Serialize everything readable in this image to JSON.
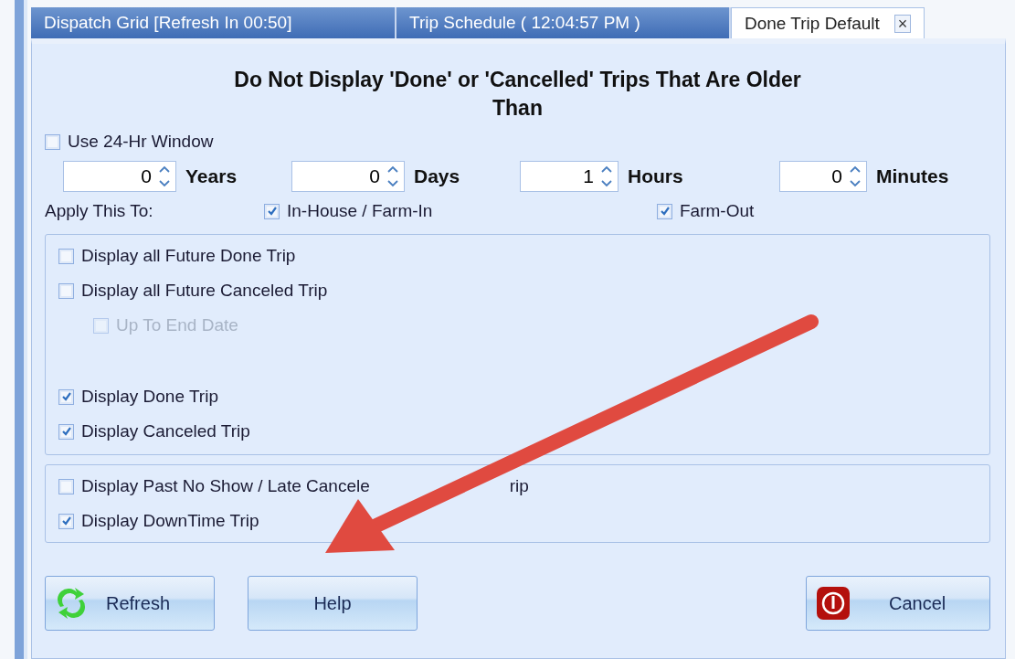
{
  "tabs": [
    {
      "label": "Dispatch Grid [Refresh In 00:50]",
      "selected": false,
      "closable": false
    },
    {
      "label": "Trip Schedule  ( 12:04:57 PM )",
      "selected": false,
      "closable": false
    },
    {
      "label": "Done Trip Default",
      "selected": true,
      "closable": true,
      "close_glyph": "×"
    }
  ],
  "heading": "Do Not Display 'Done' or 'Cancelled' Trips That Are Older Than",
  "window_option": {
    "label": "Use 24-Hr Window",
    "checked": false
  },
  "spinners": [
    {
      "value": "0",
      "unit": "Years"
    },
    {
      "value": "0",
      "unit": "Days"
    },
    {
      "value": "1",
      "unit": "Hours"
    },
    {
      "value": "0",
      "unit": "Minutes"
    }
  ],
  "apply_to": {
    "label": "Apply This To:",
    "options": [
      {
        "label": "In-House / Farm-In",
        "checked": true
      },
      {
        "label": "Farm-Out",
        "checked": true
      }
    ]
  },
  "future_options": [
    {
      "label": "Display all Future Done Trip",
      "checked": false,
      "disabled": false
    },
    {
      "label": "Display all Future Canceled Trip",
      "checked": false,
      "disabled": false,
      "children": [
        {
          "label": "Up To End Date",
          "checked": false,
          "disabled": true
        }
      ]
    }
  ],
  "current_options": [
    {
      "label": "Display Done Trip",
      "checked": true,
      "disabled": false
    },
    {
      "label": "Display Canceled Trip",
      "checked": true,
      "disabled": false
    }
  ],
  "other_options": [
    {
      "label": "Display Past No Show / Late Cancele",
      "tail": "rip",
      "checked": false
    },
    {
      "label": "Display DownTime Trip",
      "checked": true
    }
  ],
  "buttons": [
    {
      "label": "Refresh",
      "kind": "refresh"
    },
    {
      "label": "Help",
      "kind": "plain"
    },
    {
      "label": "Cancel",
      "kind": "cancel"
    }
  ],
  "annotation": {
    "kind": "arrow"
  }
}
